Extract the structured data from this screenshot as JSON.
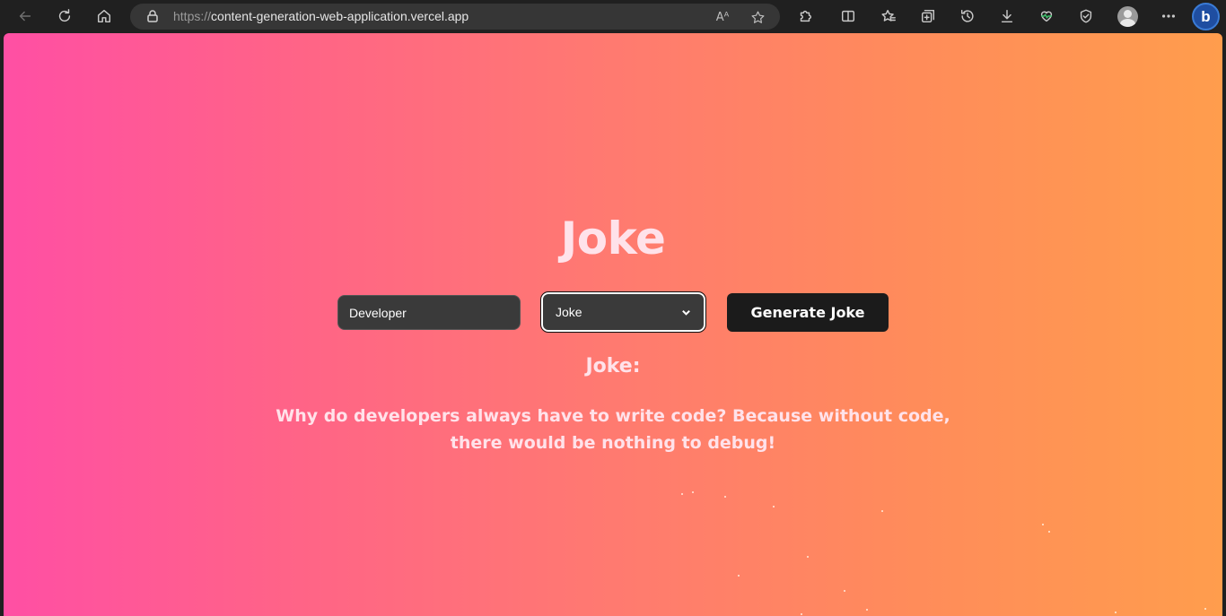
{
  "browser": {
    "url_protocol": "https://",
    "url_host": "content-generation-web-application.vercel.app",
    "read_aloud_glyph": "Aᴬ",
    "copilot_glyph": "b"
  },
  "page": {
    "title": "Joke",
    "topic_value": "Developer",
    "type_selected": "Joke",
    "generate_label": "Generate Joke",
    "result_label": "Joke:",
    "result_text": "Why do developers always have to write code? Because without code, there would be nothing to debug!"
  },
  "colors": {
    "gradient_left": "#ff4fa4",
    "gradient_right": "#ff9d4d",
    "text_light": "#ffe2ea",
    "input_bg": "#3a3a3a",
    "button_bg": "#1b1b1b"
  }
}
